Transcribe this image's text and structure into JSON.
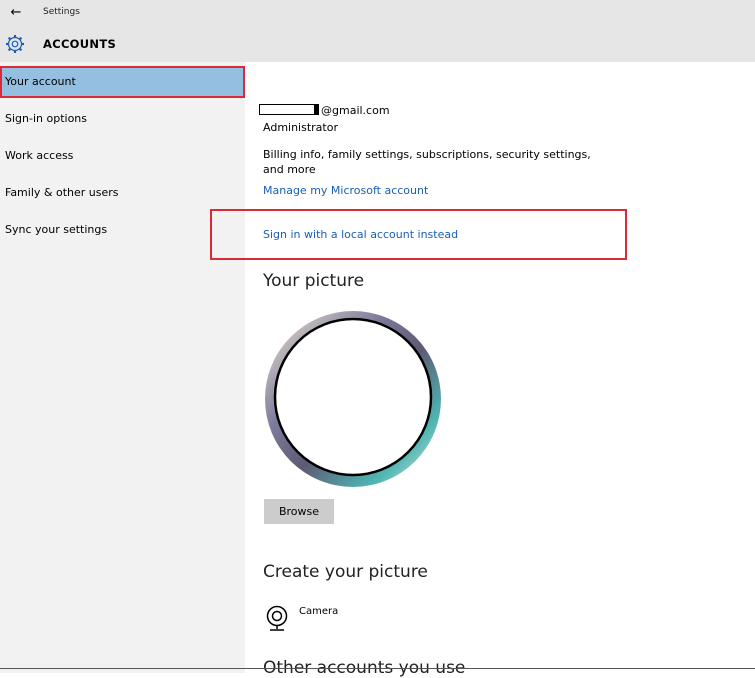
{
  "app": {
    "title": "Settings",
    "section": "ACCOUNTS"
  },
  "sidebar": {
    "items": [
      {
        "label": "Your account",
        "selected": true
      },
      {
        "label": "Sign-in options"
      },
      {
        "label": "Work access"
      },
      {
        "label": "Family & other users"
      },
      {
        "label": "Sync your settings"
      }
    ]
  },
  "account": {
    "email_domain": "@gmail.com",
    "role": "Administrator",
    "billing_text": "Billing info, family settings, subscriptions, security settings, and more",
    "manage_link": "Manage my Microsoft account",
    "local_account_link": "Sign in with a local account instead"
  },
  "picture": {
    "heading": "Your picture",
    "browse_label": "Browse"
  },
  "create_picture": {
    "heading": "Create your picture",
    "camera_label": "Camera"
  },
  "other_accounts": {
    "heading": "Other accounts you use"
  },
  "icons": {
    "back": "back-arrow-icon",
    "settings": "gear-icon",
    "camera": "camera-icon"
  },
  "colors": {
    "accent_selected": "#95bfe0",
    "highlight": "#d92b37",
    "link": "#1a5fb4"
  }
}
